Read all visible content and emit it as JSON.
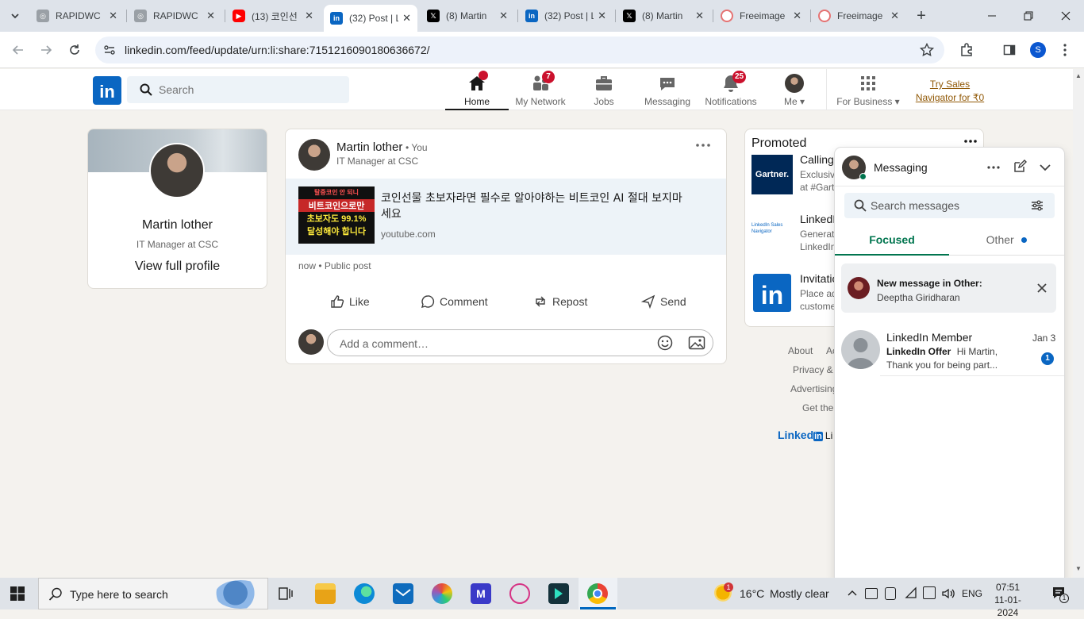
{
  "browser": {
    "tabs": [
      {
        "title": "RAPIDWC",
        "icon": "rapidwc-favicon",
        "active": false
      },
      {
        "title": "RAPIDWC",
        "icon": "rapidwc-favicon",
        "active": false
      },
      {
        "title": "(13) 코인선",
        "icon": "youtube-favicon",
        "active": false
      },
      {
        "title": "(32) Post | L",
        "icon": "linkedin-favicon",
        "active": true
      },
      {
        "title": "(8) Martin",
        "icon": "x-favicon",
        "active": false
      },
      {
        "title": "(32) Post | L",
        "icon": "linkedin-favicon",
        "active": false
      },
      {
        "title": "(8) Martin",
        "icon": "x-favicon",
        "active": false
      },
      {
        "title": "Freeimage",
        "icon": "freeimage-favicon",
        "active": false
      },
      {
        "title": "Freeimage",
        "icon": "freeimage-favicon",
        "active": false
      }
    ],
    "url": "linkedin.com/feed/update/urn:li:share:7151216090180636672/",
    "profile_initial": "S"
  },
  "header": {
    "logo_text": "in",
    "search_placeholder": "Search",
    "nav": [
      {
        "label": "Home",
        "icon": "home-icon",
        "badge": "",
        "active": true
      },
      {
        "label": "My Network",
        "icon": "network-icon",
        "badge": "7",
        "active": false
      },
      {
        "label": "Jobs",
        "icon": "briefcase-icon",
        "badge": "",
        "active": false
      },
      {
        "label": "Messaging",
        "icon": "messaging-icon",
        "badge": "",
        "active": false
      },
      {
        "label": "Notifications",
        "icon": "bell-icon",
        "badge": "25",
        "active": false
      },
      {
        "label": "Me",
        "icon": "avatar",
        "badge": "",
        "active": false
      }
    ],
    "for_business": "For Business",
    "try_sales_line1": "Try Sales",
    "try_sales_line2": "Navigator for ₹0"
  },
  "profile_card": {
    "name": "Martin lother",
    "headline": "IT Manager at CSC",
    "view_profile": "View full profile"
  },
  "post": {
    "author": "Martin lother",
    "you_tag": "• You",
    "headline": "IT Manager at CSC",
    "link_title": "코인선물 초보자라면 필수로 알아야하는 비트코인 AI 절대 보지마세요",
    "link_domain": "youtube.com",
    "thumb_line1": "탈중코인 안 되니",
    "thumb_line2": "비트코인으로만",
    "thumb_line3": "초보자도 99.1%",
    "thumb_line4": "달성해야 합니다",
    "meta": "now • Public post",
    "actions": {
      "like": "Like",
      "comment": "Comment",
      "repost": "Repost",
      "send": "Send"
    },
    "comment_placeholder": "Add a comment…"
  },
  "promoted": {
    "title": "Promoted",
    "items": [
      {
        "logo": "Gartner.",
        "title": "Calling",
        "line1": "Exclusiv",
        "line2": "at #Gart"
      },
      {
        "logo": "LinkedIn Sales Navigator",
        "title": "LinkedI",
        "line1": "Generate",
        "line2": "LinkedIn"
      },
      {
        "logo": "in",
        "title": "Invitatio",
        "line1": "Place ad",
        "line2": "custome"
      }
    ]
  },
  "footer": {
    "links": [
      "About",
      "Ac",
      "Privacy &",
      "Advertising",
      "Get the"
    ],
    "brand": "Linked",
    "brand_in": "in",
    "brand_suffix": "Li"
  },
  "messaging": {
    "title": "Messaging",
    "search_placeholder": "Search messages",
    "tab_focused": "Focused",
    "tab_other": "Other",
    "notice_title": "New message in Other:",
    "notice_name": "Deeptha Giridharan",
    "conversation": {
      "name": "LinkedIn Member",
      "date": "Jan 3",
      "sender": "LinkedIn Offer",
      "preview_line1": "Hi Martin,",
      "preview_line2": "Thank you for being part...",
      "unread": "1"
    }
  },
  "taskbar": {
    "search_placeholder": "Type here to search",
    "weather_temp": "16°C",
    "weather_text": "Mostly clear",
    "weather_badge": "1",
    "language": "ENG",
    "time": "07:51",
    "date": "11-01-2024",
    "notif_count": "1"
  }
}
